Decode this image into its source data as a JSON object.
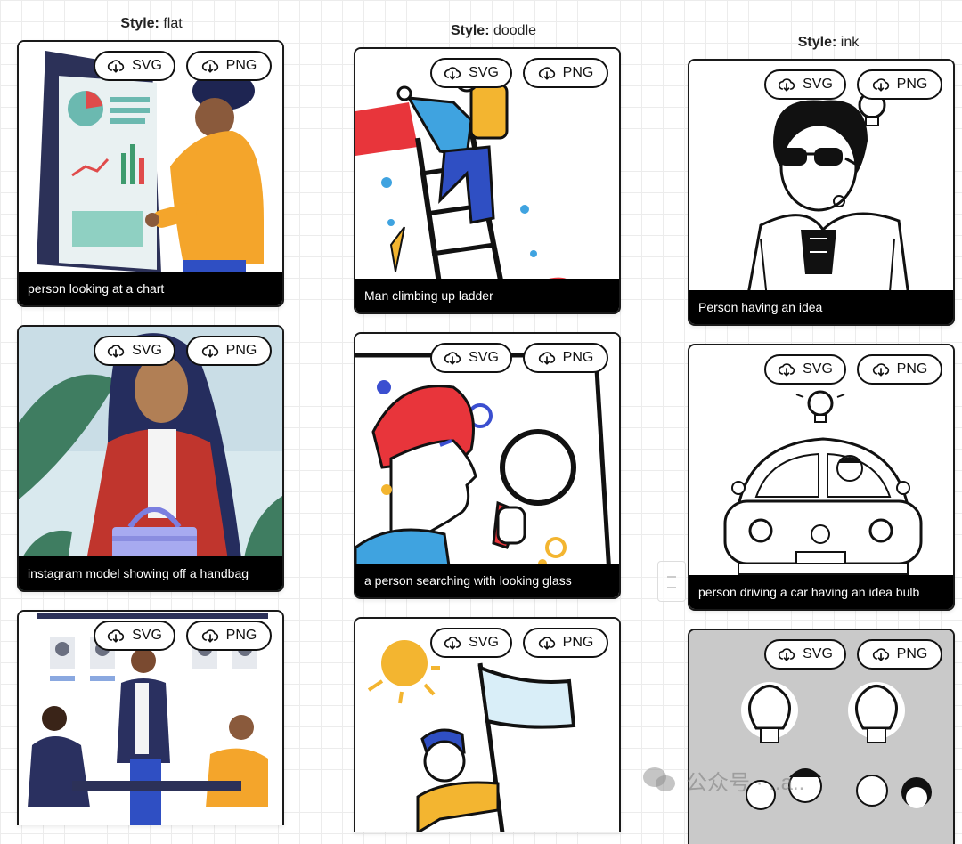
{
  "columns": [
    {
      "label": "Style:",
      "style": "flat",
      "cards": [
        {
          "caption": "person looking at a chart",
          "svg": "SVG",
          "png": "PNG"
        },
        {
          "caption": "instagram model showing off a handbag",
          "svg": "SVG",
          "png": "PNG"
        },
        {
          "caption": "",
          "svg": "SVG",
          "png": "PNG"
        }
      ]
    },
    {
      "label": "Style:",
      "style": "doodle",
      "cards": [
        {
          "caption": "Man climbing up ladder",
          "svg": "SVG",
          "png": "PNG"
        },
        {
          "caption": "a person searching with looking glass",
          "svg": "SVG",
          "png": "PNG"
        },
        {
          "caption": "",
          "svg": "SVG",
          "png": "PNG"
        }
      ]
    },
    {
      "label": "Style:",
      "style": "ink",
      "cards": [
        {
          "caption": "Person having an idea",
          "svg": "SVG",
          "png": "PNG"
        },
        {
          "caption": "person driving a car having an idea bulb",
          "svg": "SVG",
          "png": "PNG"
        },
        {
          "caption": "",
          "svg": "SVG",
          "png": "PNG"
        }
      ]
    }
  ],
  "watermark": {
    "text": "公众号 · ..a.."
  },
  "icons": {
    "download": "cloud-download-icon"
  },
  "colors": {
    "caption_bg": "#000000",
    "border": "#1a1a1a",
    "grid": "#ececec"
  }
}
